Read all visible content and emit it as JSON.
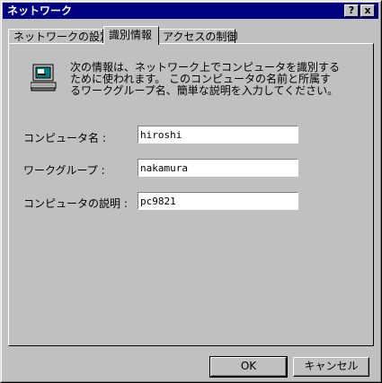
{
  "window": {
    "title": "ネットワーク",
    "help_button": "?",
    "close_button": "x"
  },
  "tabs": [
    {
      "label": "ネットワークの設定"
    },
    {
      "label": "識別情報"
    },
    {
      "label": "アクセスの制御"
    }
  ],
  "description": "次の情報は、ネットワーク上でコンピュータを識別するために使われます。 このコンピュータの名前と所属するワークグループ名、簡単な説明を入力してください。",
  "fields": {
    "computer_name": {
      "label": "コンピュータ名 :",
      "value": "hiroshi"
    },
    "workgroup": {
      "label": "ワークグループ :",
      "value": "nakamura"
    },
    "computer_description": {
      "label": "コンピュータの説明 :",
      "value": "pc9821"
    }
  },
  "buttons": {
    "ok": "OK",
    "cancel": "キャンセル"
  }
}
